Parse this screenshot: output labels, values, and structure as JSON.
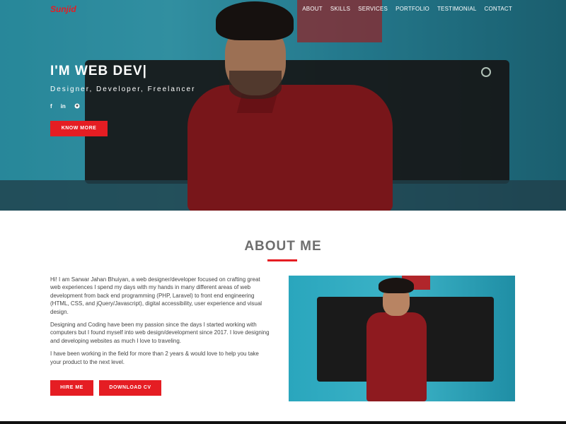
{
  "brand": {
    "logo": "Sunjid",
    "accent": "#e51d23"
  },
  "nav": {
    "items": [
      "ABOUT",
      "SKILLS",
      "SERVICES",
      "PORTFOLIO",
      "TESTIMONIAL",
      "CONTACT"
    ]
  },
  "hero": {
    "headline": "I'M WEB DEV|",
    "subline": "Designer, Developer, Freelancer",
    "socials": [
      "f",
      "in",
      "gh"
    ],
    "button": "KNOW MORE"
  },
  "about": {
    "title": "ABOUT ME",
    "paragraphs": [
      "Hi! I am Sarwar Jahan Bhuiyan, a web designer/developer focused on crafting great web experiences I spend my days with my hands in many different areas of web development from back end programming (PHP, Laravel) to front end engineering (HTML, CSS, and jQuery/Javascript), digital accessibility, user experience and visual design.",
      "Designing and Coding have been my passion since the days I started working with computers but I found myself into web design/development since 2017. I love designing and developing websites as much I love to traveling.",
      "I have been working in the field for more than 2 years & would love to help you take your product to the next level."
    ],
    "hire_button": "HIRE ME",
    "cv_button": "DOWNLOAD CV"
  }
}
